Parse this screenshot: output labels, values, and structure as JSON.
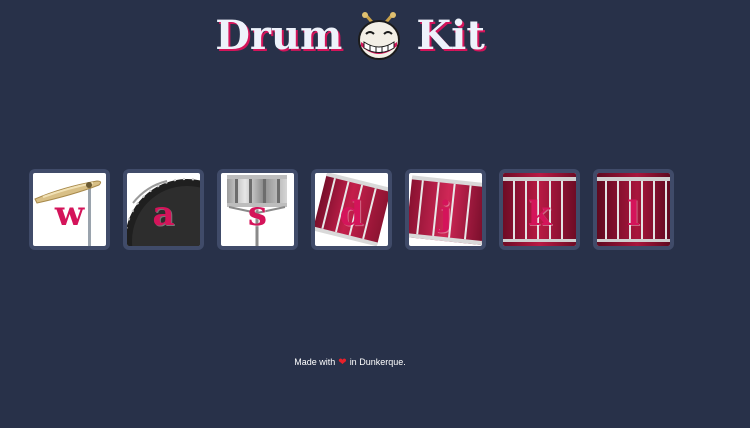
{
  "header": {
    "title_left": "Drum",
    "title_right": "Kit",
    "logo_icon": "drum-face-icon"
  },
  "keys": [
    {
      "letter": "w",
      "instrument_icon": "cymbal-icon"
    },
    {
      "letter": "a",
      "instrument_icon": "bass-drum-icon"
    },
    {
      "letter": "s",
      "instrument_icon": "snare-drum-icon"
    },
    {
      "letter": "d",
      "instrument_icon": "tom-drum-tilted-icon"
    },
    {
      "letter": "j",
      "instrument_icon": "tom-drum-icon"
    },
    {
      "letter": "k",
      "instrument_icon": "floor-tom-icon"
    },
    {
      "letter": "l",
      "instrument_icon": "floor-tom-large-icon"
    }
  ],
  "footer": {
    "prefix": "Made with",
    "heart_icon": "heart-icon",
    "suffix": "in Dunkerque."
  },
  "colors": {
    "background": "#283149",
    "key_border": "#404b69",
    "accent": "#d4145a",
    "drum_red": "#a8163c"
  }
}
